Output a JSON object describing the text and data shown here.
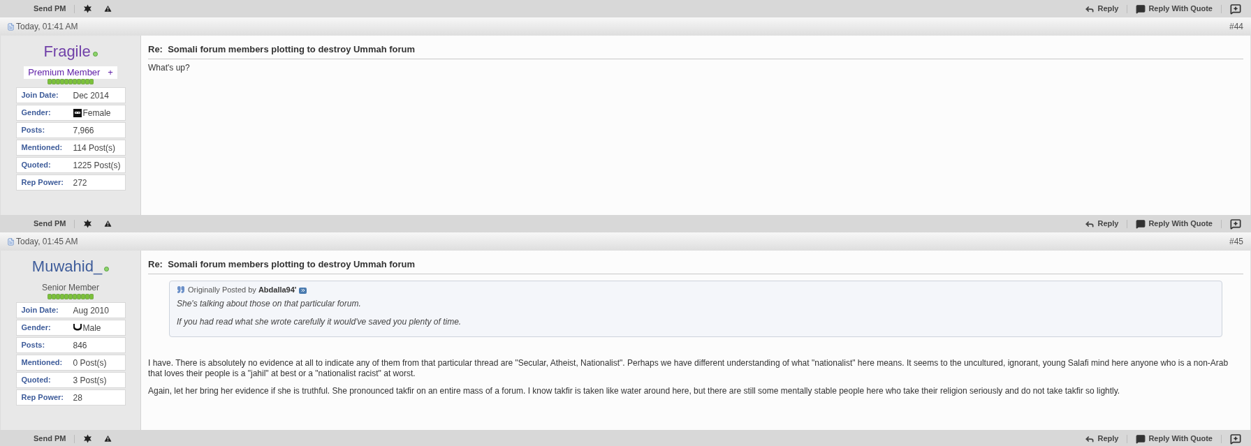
{
  "toolbars": [
    {
      "send_pm": "Send PM",
      "reply": "Reply",
      "reply_with_quote": "Reply With Quote"
    },
    {
      "send_pm": "Send PM",
      "reply": "Reply",
      "reply_with_quote": "Reply With Quote"
    },
    {
      "send_pm": "Send PM",
      "reply": "Reply",
      "reply_with_quote": "Reply With Quote"
    }
  ],
  "posts": [
    {
      "date": "Today, 01:41 AM",
      "number": "#44",
      "username": "Fragile",
      "color": "#7040a8",
      "online": true,
      "rank": {
        "kind": "highlighted",
        "text": "Premium Member   +"
      },
      "stats": [
        {
          "label": "Join Date:",
          "value": "Dec 2014"
        },
        {
          "label": "Gender:",
          "value": "Female",
          "kind": "female"
        },
        {
          "label": "Posts:",
          "value": "7,966"
        },
        {
          "label": "Mentioned:",
          "value": "114 Post(s)"
        },
        {
          "label": "Quoted:",
          "value": "1225 Post(s)"
        },
        {
          "label": "Rep Power:",
          "value": "272"
        }
      ],
      "title": "Re:  Somali forum members plotting to destroy Ummah forum",
      "paragraphs": [
        "What's up?"
      ]
    },
    {
      "date": "Today, 01:45 AM",
      "number": "#45",
      "username": "Muwahid_",
      "color": "#3e5c9a",
      "online": true,
      "rank": {
        "kind": "plain",
        "text": "Senior Member"
      },
      "stats": [
        {
          "label": "Join Date:",
          "value": "Aug 2010"
        },
        {
          "label": "Gender:",
          "value": "Male",
          "kind": "male"
        },
        {
          "label": "Posts:",
          "value": "846"
        },
        {
          "label": "Mentioned:",
          "value": "0 Post(s)"
        },
        {
          "label": "Quoted:",
          "value": "3 Post(s)"
        },
        {
          "label": "Rep Power:",
          "value": "28"
        }
      ],
      "title": "Re:  Somali forum members plotting to destroy Ummah forum",
      "quote": {
        "prefix": "Originally Posted by",
        "author": "Abdalla94'",
        "lines": [
          "She's talking about those on that particular forum.",
          "If you had read what she wrote carefully it would've saved you plenty of time."
        ]
      },
      "paragraphs": [
        "I have. There is absolutely no evidence at all to indicate any of them from that particular thread are \"Secular, Atheist, Nationalist\". Perhaps we have different understanding of what \"nationalist\" here means. It seems to the uncultured, ignorant, young Salafi mind here anyone who is a non-Arab that loves their people is a \"jahil\" at best or a \"nationalist racist\" at worst.",
        "Again, let her bring her evidence if she is truthful. She pronounced takfir on an entire mass of a forum. I know takfir is taken like water around here, but there are still some mentally stable people here who take their religion seriously and do not take takfir so lightly."
      ]
    }
  ]
}
